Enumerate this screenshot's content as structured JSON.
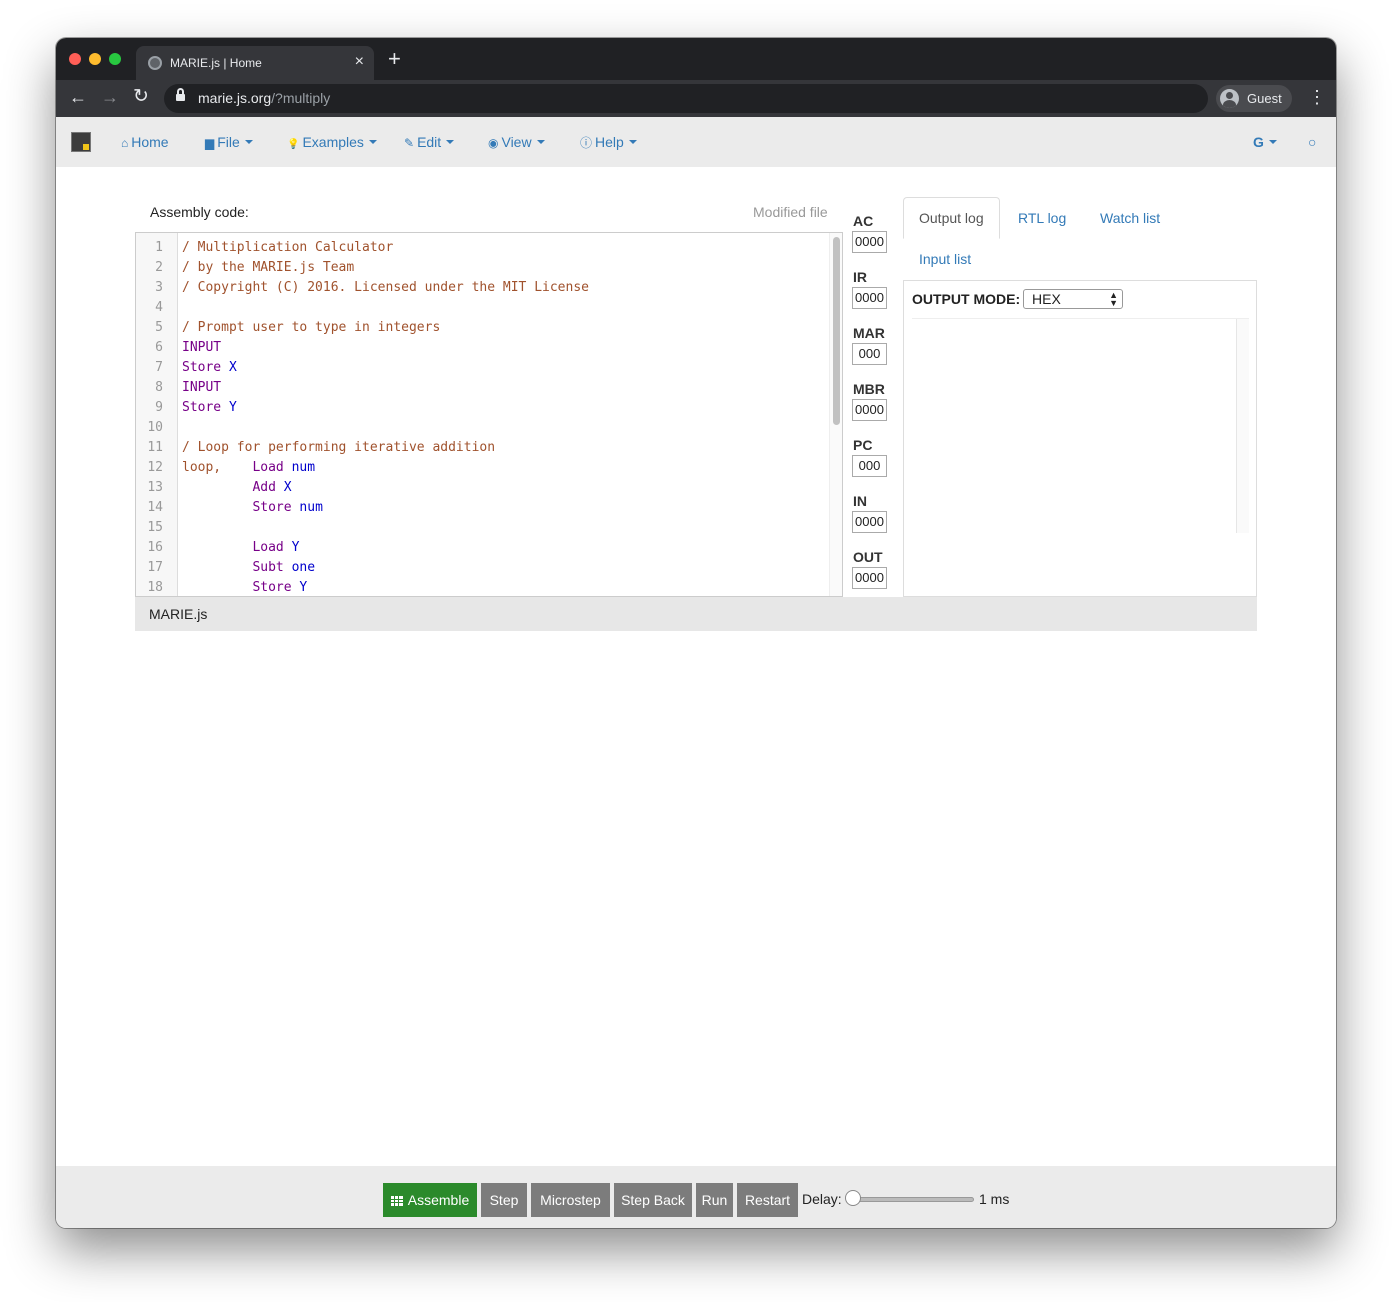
{
  "browser": {
    "tab_title": "MARIE.js | Home",
    "tab_close": "×",
    "new_tab": "+",
    "url_host": "marie.js.org",
    "url_path": "/?multiply",
    "profile_label": "Guest",
    "menu_glyph": "⋮",
    "back_glyph": "←",
    "forward_glyph": "→",
    "reload_glyph": "↻"
  },
  "navbar": {
    "items": [
      {
        "label": "Home",
        "icon": "home-icon",
        "glyph": "⌂"
      },
      {
        "label": "File",
        "icon": "file-icon",
        "glyph": "▆"
      },
      {
        "label": "Examples",
        "icon": "lightbulb-icon",
        "glyph": "💡"
      },
      {
        "label": "Edit",
        "icon": "pencil-icon",
        "glyph": "✎"
      },
      {
        "label": "View",
        "icon": "eye-icon",
        "glyph": "◉"
      },
      {
        "label": "Help",
        "icon": "question-icon",
        "glyph": "ⓘ"
      }
    ],
    "google_label": "G",
    "github_glyph": "○"
  },
  "editor": {
    "label": "Assembly code:",
    "modified_label": "Modified file",
    "lines": [
      {
        "n": "1",
        "parts": [
          {
            "t": "/ Multiplication Calculator",
            "c": "comment"
          }
        ]
      },
      {
        "n": "2",
        "parts": [
          {
            "t": "/ by the MARIE.js Team",
            "c": "comment"
          }
        ]
      },
      {
        "n": "3",
        "parts": [
          {
            "t": "/ Copyright (C) 2016. Licensed under the MIT License",
            "c": "comment"
          }
        ]
      },
      {
        "n": "4",
        "parts": []
      },
      {
        "n": "5",
        "parts": [
          {
            "t": "/ Prompt user to type in integers",
            "c": "comment"
          }
        ]
      },
      {
        "n": "6",
        "parts": [
          {
            "t": "INPUT",
            "c": "kw"
          }
        ]
      },
      {
        "n": "7",
        "parts": [
          {
            "t": "Store ",
            "c": "kw"
          },
          {
            "t": "X",
            "c": "var"
          }
        ]
      },
      {
        "n": "8",
        "parts": [
          {
            "t": "INPUT",
            "c": "kw"
          }
        ]
      },
      {
        "n": "9",
        "parts": [
          {
            "t": "Store ",
            "c": "kw"
          },
          {
            "t": "Y",
            "c": "var"
          }
        ]
      },
      {
        "n": "10",
        "parts": []
      },
      {
        "n": "11",
        "parts": [
          {
            "t": "/ Loop for performing iterative addition",
            "c": "comment"
          }
        ]
      },
      {
        "n": "12",
        "parts": [
          {
            "t": "loop,    ",
            "c": "label"
          },
          {
            "t": "Load ",
            "c": "kw"
          },
          {
            "t": "num",
            "c": "var"
          }
        ]
      },
      {
        "n": "13",
        "parts": [
          {
            "t": "         ",
            "c": "plain"
          },
          {
            "t": "Add ",
            "c": "kw"
          },
          {
            "t": "X",
            "c": "var"
          }
        ]
      },
      {
        "n": "14",
        "parts": [
          {
            "t": "         ",
            "c": "plain"
          },
          {
            "t": "Store ",
            "c": "kw"
          },
          {
            "t": "num",
            "c": "var"
          }
        ]
      },
      {
        "n": "15",
        "parts": []
      },
      {
        "n": "16",
        "parts": [
          {
            "t": "         ",
            "c": "plain"
          },
          {
            "t": "Load ",
            "c": "kw"
          },
          {
            "t": "Y",
            "c": "var"
          }
        ]
      },
      {
        "n": "17",
        "parts": [
          {
            "t": "         ",
            "c": "plain"
          },
          {
            "t": "Subt ",
            "c": "kw"
          },
          {
            "t": "one",
            "c": "var"
          }
        ]
      },
      {
        "n": "18",
        "parts": [
          {
            "t": "         ",
            "c": "plain"
          },
          {
            "t": "Store ",
            "c": "kw"
          },
          {
            "t": "Y",
            "c": "var"
          }
        ]
      }
    ]
  },
  "status": {
    "text": "MARIE.js"
  },
  "registers": [
    {
      "name": "AC",
      "value": "0000"
    },
    {
      "name": "IR",
      "value": "0000"
    },
    {
      "name": "MAR",
      "value": "000"
    },
    {
      "name": "MBR",
      "value": "0000"
    },
    {
      "name": "PC",
      "value": "000"
    },
    {
      "name": "IN",
      "value": "0000"
    },
    {
      "name": "OUT",
      "value": "0000"
    }
  ],
  "right_tabs": {
    "active": "Output log",
    "others": [
      "RTL log",
      "Watch list",
      "Input list"
    ]
  },
  "output": {
    "mode_label": "OUTPUT MODE:",
    "mode_value": "HEX"
  },
  "controls": {
    "assemble": "Assemble",
    "step": "Step",
    "microstep": "Microstep",
    "step_back": "Step Back",
    "run": "Run",
    "restart": "Restart",
    "delay_label": "Delay:",
    "delay_value": "1 ms",
    "delay_level": 0
  }
}
